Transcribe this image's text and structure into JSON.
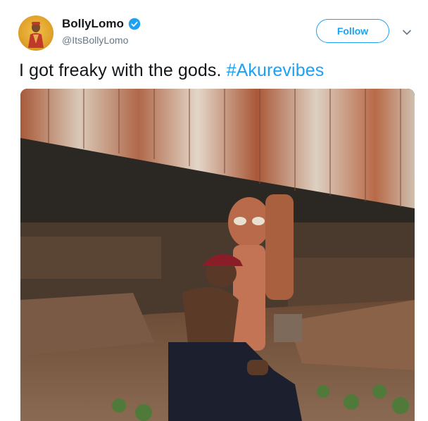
{
  "tweet": {
    "author": {
      "display_name": "BollyLomo",
      "handle": "@ItsBollyLomo",
      "verified": true
    },
    "follow_label": "Follow",
    "text_main": "I got freaky with the gods. ",
    "hashtag": "#Akurevibes"
  },
  "icons": {
    "verified": "verified-badge-icon",
    "menu": "chevron-down-icon"
  },
  "colors": {
    "accent": "#1da1f2",
    "text": "#14171a",
    "muted": "#657786"
  }
}
